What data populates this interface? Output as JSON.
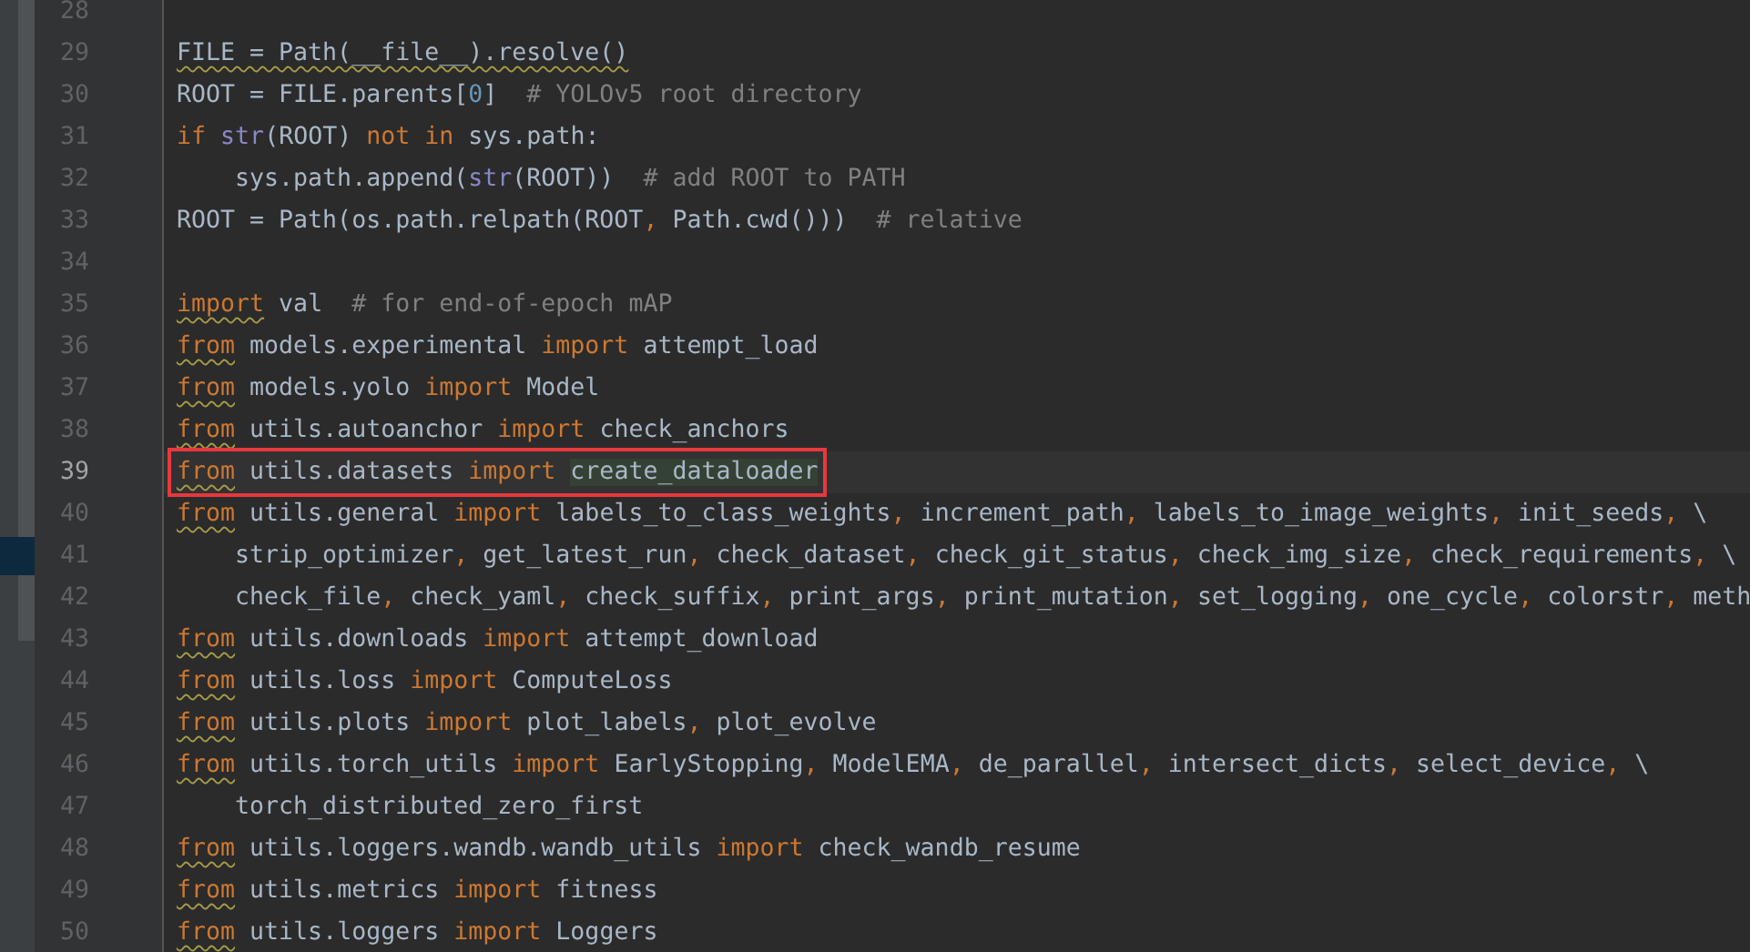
{
  "editor": {
    "lines": [
      {
        "number": "28",
        "current": false,
        "boxed": false
      },
      {
        "number": "29",
        "current": false,
        "boxed": false,
        "tokens": [
          {
            "kind": "text",
            "text": "FILE = Path(__file__).resolve()",
            "warn": true
          }
        ]
      },
      {
        "number": "30",
        "current": false,
        "boxed": false,
        "tokens": [
          {
            "kind": "text",
            "text": "ROOT = FILE.parents["
          },
          {
            "kind": "number",
            "text": "0"
          },
          {
            "kind": "text",
            "text": "]  "
          },
          {
            "kind": "comment",
            "text": "# YOLOv5 root directory"
          }
        ]
      },
      {
        "number": "31",
        "current": false,
        "boxed": false,
        "tokens": [
          {
            "kind": "kw",
            "text": "if "
          },
          {
            "kind": "builtin",
            "text": "str"
          },
          {
            "kind": "text",
            "text": "(ROOT) "
          },
          {
            "kind": "kw",
            "text": "not in "
          },
          {
            "kind": "text",
            "text": "sys.path:"
          }
        ]
      },
      {
        "number": "32",
        "current": false,
        "boxed": false,
        "tokens": [
          {
            "kind": "text",
            "text": "    sys.path.append("
          },
          {
            "kind": "builtin",
            "text": "str"
          },
          {
            "kind": "text",
            "text": "(ROOT))  "
          },
          {
            "kind": "comment",
            "text": "# add ROOT to PATH"
          }
        ]
      },
      {
        "number": "33",
        "current": false,
        "boxed": false,
        "tokens": [
          {
            "kind": "text",
            "text": "ROOT = Path(os.path.relpath(ROOT"
          },
          {
            "kind": "sep",
            "text": ", "
          },
          {
            "kind": "text",
            "text": "Path.cwd()))  "
          },
          {
            "kind": "comment",
            "text": "# relative"
          }
        ]
      },
      {
        "number": "34",
        "current": false,
        "boxed": false
      },
      {
        "number": "35",
        "current": false,
        "boxed": false,
        "tokens": [
          {
            "kind": "kw",
            "text": "import",
            "warn": true
          },
          {
            "kind": "text",
            "text": " val  "
          },
          {
            "kind": "comment",
            "text": "# for end-of-epoch mAP"
          }
        ]
      },
      {
        "number": "36",
        "current": false,
        "boxed": false,
        "tokens": [
          {
            "kind": "kw",
            "text": "from",
            "warn": true
          },
          {
            "kind": "text",
            "text": " models.experimental "
          },
          {
            "kind": "kw",
            "text": "import "
          },
          {
            "kind": "text",
            "text": "attempt_load"
          }
        ]
      },
      {
        "number": "37",
        "current": false,
        "boxed": false,
        "tokens": [
          {
            "kind": "kw",
            "text": "from",
            "warn": true
          },
          {
            "kind": "text",
            "text": " models.yolo "
          },
          {
            "kind": "kw",
            "text": "import "
          },
          {
            "kind": "text",
            "text": "Model"
          }
        ]
      },
      {
        "number": "38",
        "current": false,
        "boxed": false,
        "tokens": [
          {
            "kind": "kw",
            "text": "from",
            "warn": true
          },
          {
            "kind": "text",
            "text": " utils.autoanchor "
          },
          {
            "kind": "kw",
            "text": "import "
          },
          {
            "kind": "text",
            "text": "check_anchors"
          }
        ]
      },
      {
        "number": "39",
        "current": true,
        "boxed": true,
        "tokens": [
          {
            "kind": "kw",
            "text": "from",
            "warn": true
          },
          {
            "kind": "text",
            "text": " utils.datasets "
          },
          {
            "kind": "kw",
            "text": "import "
          },
          {
            "kind": "text",
            "text": "create_dataloader",
            "match": true
          }
        ]
      },
      {
        "number": "40",
        "current": false,
        "boxed": false,
        "tokens": [
          {
            "kind": "kw",
            "text": "from",
            "warn": true
          },
          {
            "kind": "text",
            "text": " utils.general "
          },
          {
            "kind": "kw",
            "text": "import "
          },
          {
            "kind": "text",
            "text": "labels_to_class_weights"
          },
          {
            "kind": "sep",
            "text": ", "
          },
          {
            "kind": "text",
            "text": "increment_path"
          },
          {
            "kind": "sep",
            "text": ", "
          },
          {
            "kind": "text",
            "text": "labels_to_image_weights"
          },
          {
            "kind": "sep",
            "text": ", "
          },
          {
            "kind": "text",
            "text": "init_seeds"
          },
          {
            "kind": "sep",
            "text": ", "
          },
          {
            "kind": "text",
            "text": "\\"
          }
        ]
      },
      {
        "number": "41",
        "current": false,
        "boxed": false,
        "tokens": [
          {
            "kind": "text",
            "text": "    strip_optimizer"
          },
          {
            "kind": "sep",
            "text": ", "
          },
          {
            "kind": "text",
            "text": "get_latest_run"
          },
          {
            "kind": "sep",
            "text": ", "
          },
          {
            "kind": "text",
            "text": "check_dataset"
          },
          {
            "kind": "sep",
            "text": ", "
          },
          {
            "kind": "text",
            "text": "check_git_status"
          },
          {
            "kind": "sep",
            "text": ", "
          },
          {
            "kind": "text",
            "text": "check_img_size"
          },
          {
            "kind": "sep",
            "text": ", "
          },
          {
            "kind": "text",
            "text": "check_requirements"
          },
          {
            "kind": "sep",
            "text": ", "
          },
          {
            "kind": "text",
            "text": "\\"
          }
        ]
      },
      {
        "number": "42",
        "current": false,
        "boxed": false,
        "tokens": [
          {
            "kind": "text",
            "text": "    check_file"
          },
          {
            "kind": "sep",
            "text": ", "
          },
          {
            "kind": "text",
            "text": "check_yaml"
          },
          {
            "kind": "sep",
            "text": ", "
          },
          {
            "kind": "text",
            "text": "check_suffix"
          },
          {
            "kind": "sep",
            "text": ", "
          },
          {
            "kind": "text",
            "text": "print_args"
          },
          {
            "kind": "sep",
            "text": ", "
          },
          {
            "kind": "text",
            "text": "print_mutation"
          },
          {
            "kind": "sep",
            "text": ", "
          },
          {
            "kind": "text",
            "text": "set_logging"
          },
          {
            "kind": "sep",
            "text": ", "
          },
          {
            "kind": "text",
            "text": "one_cycle"
          },
          {
            "kind": "sep",
            "text": ", "
          },
          {
            "kind": "text",
            "text": "colorstr"
          },
          {
            "kind": "sep",
            "text": ", "
          },
          {
            "kind": "text",
            "text": "meth"
          }
        ]
      },
      {
        "number": "43",
        "current": false,
        "boxed": false,
        "tokens": [
          {
            "kind": "kw",
            "text": "from",
            "warn": true
          },
          {
            "kind": "text",
            "text": " utils.downloads "
          },
          {
            "kind": "kw",
            "text": "import "
          },
          {
            "kind": "text",
            "text": "attempt_download"
          }
        ]
      },
      {
        "number": "44",
        "current": false,
        "boxed": false,
        "tokens": [
          {
            "kind": "kw",
            "text": "from",
            "warn": true
          },
          {
            "kind": "text",
            "text": " utils.loss "
          },
          {
            "kind": "kw",
            "text": "import "
          },
          {
            "kind": "text",
            "text": "ComputeLoss"
          }
        ]
      },
      {
        "number": "45",
        "current": false,
        "boxed": false,
        "tokens": [
          {
            "kind": "kw",
            "text": "from",
            "warn": true
          },
          {
            "kind": "text",
            "text": " utils.plots "
          },
          {
            "kind": "kw",
            "text": "import "
          },
          {
            "kind": "text",
            "text": "plot_labels"
          },
          {
            "kind": "sep",
            "text": ", "
          },
          {
            "kind": "text",
            "text": "plot_evolve"
          }
        ]
      },
      {
        "number": "46",
        "current": false,
        "boxed": false,
        "tokens": [
          {
            "kind": "kw",
            "text": "from",
            "warn": true
          },
          {
            "kind": "text",
            "text": " utils.torch_utils "
          },
          {
            "kind": "kw",
            "text": "import "
          },
          {
            "kind": "text",
            "text": "EarlyStopping"
          },
          {
            "kind": "sep",
            "text": ", "
          },
          {
            "kind": "text",
            "text": "ModelEMA"
          },
          {
            "kind": "sep",
            "text": ", "
          },
          {
            "kind": "text",
            "text": "de_parallel"
          },
          {
            "kind": "sep",
            "text": ", "
          },
          {
            "kind": "text",
            "text": "intersect_dicts"
          },
          {
            "kind": "sep",
            "text": ", "
          },
          {
            "kind": "text",
            "text": "select_device"
          },
          {
            "kind": "sep",
            "text": ", "
          },
          {
            "kind": "text",
            "text": "\\"
          }
        ]
      },
      {
        "number": "47",
        "current": false,
        "boxed": false,
        "tokens": [
          {
            "kind": "text",
            "text": "    torch_distributed_zero_first"
          }
        ]
      },
      {
        "number": "48",
        "current": false,
        "boxed": false,
        "tokens": [
          {
            "kind": "kw",
            "text": "from",
            "warn": true
          },
          {
            "kind": "text",
            "text": " utils.loggers.wandb.wandb_utils "
          },
          {
            "kind": "kw",
            "text": "import "
          },
          {
            "kind": "text",
            "text": "check_wandb_resume"
          }
        ]
      },
      {
        "number": "49",
        "current": false,
        "boxed": false,
        "tokens": [
          {
            "kind": "kw",
            "text": "from",
            "warn": true
          },
          {
            "kind": "text",
            "text": " utils.metrics "
          },
          {
            "kind": "kw",
            "text": "import "
          },
          {
            "kind": "text",
            "text": "fitness"
          }
        ]
      },
      {
        "number": "50",
        "current": false,
        "boxed": false,
        "tokens": [
          {
            "kind": "kw",
            "text": "from",
            "warn": true
          },
          {
            "kind": "text",
            "text": " utils.loggers "
          },
          {
            "kind": "kw",
            "text": "import "
          },
          {
            "kind": "text",
            "text": "Loggers"
          }
        ]
      }
    ]
  }
}
